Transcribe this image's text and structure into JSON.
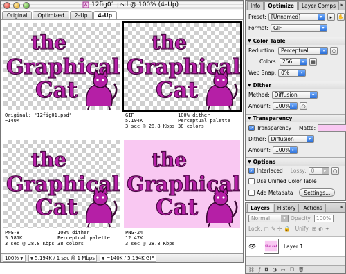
{
  "document": {
    "title": "12fig01.psd @ 100% (4–Up)",
    "tabs": [
      {
        "label": "Original",
        "active": false
      },
      {
        "label": "Optimized",
        "active": false
      },
      {
        "label": "2–Up",
        "active": false
      },
      {
        "label": "4–Up",
        "active": true
      }
    ],
    "artwork_text": [
      "the",
      "Graphical",
      "Cat"
    ],
    "panes": [
      {
        "l1c1": "Original: \"12fig01.psd\"",
        "l1c2": "",
        "l2c1": "~140K",
        "l2c2": "",
        "l3c1": "",
        "l3c2": "",
        "l4c1": "",
        "l4c2": ""
      },
      {
        "l1c1": "GIF",
        "l1c2": "100% dither",
        "l2c1": "5.194K",
        "l2c2": "Perceptual palette",
        "l3c1": "3 sec @ 28.8 Kbps",
        "l3c2": "38 colors",
        "l4c1": "",
        "l4c2": ""
      },
      {
        "l1c1": "PNG-8",
        "l1c2": "100% dither",
        "l2c1": "5.581K",
        "l2c2": "Perceptual palette",
        "l3c1": "3 sec @ 28.8 Kbps",
        "l3c2": "38 colors",
        "l4c1": "",
        "l4c2": ""
      },
      {
        "l1c1": "PNG-24",
        "l1c2": "",
        "l2c1": "12.47K",
        "l2c2": "",
        "l3c1": "3 sec @ 28.8 Kbps",
        "l3c2": "",
        "l4c1": "",
        "l4c2": ""
      }
    ],
    "status": {
      "zoom": "100%",
      "speed": "5.194K / 1 sec @ 1 Mbps",
      "size": "~140K / 5.194K GIF"
    }
  },
  "optimize_palette": {
    "tabs": [
      {
        "label": "Info",
        "active": false
      },
      {
        "label": "Optimize",
        "active": true
      },
      {
        "label": "Layer Comps",
        "active": false
      }
    ],
    "preset_label": "Preset:",
    "preset_value": "[Unnamed]",
    "format_label": "Format:",
    "format_value": "GIF",
    "color_table": {
      "title": "Color Table",
      "reduction_label": "Reduction:",
      "reduction_value": "Perceptual",
      "colors_label": "Colors:",
      "colors_value": "256",
      "websnap_label": "Web Snap:",
      "websnap_value": "0%"
    },
    "dither": {
      "title": "Dither",
      "method_label": "Method:",
      "method_value": "Diffusion",
      "amount_label": "Amount:",
      "amount_value": "100%"
    },
    "transparency": {
      "title": "Transparency",
      "checkbox_label": "Transparency",
      "checked": true,
      "matte_label": "Matte:",
      "matte_color": "#f9c8f2",
      "dither_label": "Dither:",
      "dither_value": "Diffusion",
      "amount_label": "Amount:",
      "amount_value": "100%"
    },
    "options": {
      "title": "Options",
      "interlaced_label": "Interlaced",
      "interlaced_checked": true,
      "lossy_label": "Lossy:",
      "lossy_value": "0",
      "unified_label": "Use Unified Color Table",
      "unified_checked": false,
      "metadata_label": "Add Metadata",
      "metadata_checked": false,
      "settings_button": "Settings..."
    }
  },
  "layers_palette": {
    "tabs": [
      {
        "label": "Layers",
        "active": true
      },
      {
        "label": "History",
        "active": false
      },
      {
        "label": "Actions",
        "active": false
      }
    ],
    "blend_mode": "Normal",
    "opacity_label": "Opacity:",
    "opacity_value": "100%",
    "lock_label": "Lock:",
    "unify_label": "Unify:",
    "layer_name": "Layer 1",
    "thumb_text": "the cat"
  },
  "colors": {
    "accent_blue": "#2b6fd8",
    "magenta_art": "#b51fa6",
    "matte_pink": "#f9c8f2"
  }
}
